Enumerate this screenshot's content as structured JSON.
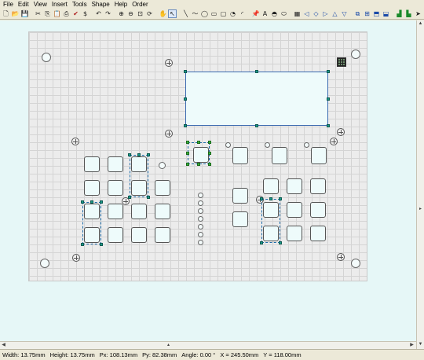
{
  "menu": [
    "File",
    "Edit",
    "View",
    "Insert",
    "Tools",
    "Shape",
    "Help",
    "Order"
  ],
  "toolbar": {
    "buttons": [
      {
        "name": "new-icon",
        "glyph": "🗋"
      },
      {
        "name": "open-icon",
        "glyph": "📂"
      },
      {
        "name": "save-icon",
        "glyph": "💾"
      },
      {
        "name": "cut-icon",
        "glyph": "✂"
      },
      {
        "name": "copy-icon",
        "glyph": "⎘"
      },
      {
        "name": "paste-icon",
        "glyph": "📋"
      },
      {
        "name": "print-icon",
        "glyph": "⎙"
      },
      {
        "name": "spellcheck-icon",
        "glyph": "✔"
      },
      {
        "name": "price-icon",
        "glyph": "$"
      },
      {
        "name": "undo-icon",
        "glyph": "↶"
      },
      {
        "name": "redo-icon",
        "glyph": "↷"
      },
      {
        "name": "zoom-in-icon",
        "glyph": "⊕"
      },
      {
        "name": "zoom-out-icon",
        "glyph": "⊖"
      },
      {
        "name": "zoom-fit-icon",
        "glyph": "⊡"
      },
      {
        "name": "rotate-icon",
        "glyph": "⟳"
      },
      {
        "name": "hand-icon",
        "glyph": "✋"
      },
      {
        "name": "pointer-icon",
        "glyph": "↖"
      },
      {
        "name": "line-icon",
        "glyph": "╲"
      },
      {
        "name": "polyline-icon",
        "glyph": "〜"
      },
      {
        "name": "ellipse-icon",
        "glyph": "◯"
      },
      {
        "name": "rectangle-icon",
        "glyph": "▭"
      },
      {
        "name": "rounded-rect-icon",
        "glyph": "▢"
      },
      {
        "name": "hole-icon",
        "glyph": "◔"
      },
      {
        "name": "arc-icon",
        "glyph": "◜"
      },
      {
        "name": "pin-icon",
        "glyph": "📌"
      },
      {
        "name": "text-icon",
        "glyph": "A"
      },
      {
        "name": "engrave-icon",
        "glyph": "◓"
      },
      {
        "name": "macro-icon",
        "glyph": "⬭"
      },
      {
        "name": "grid-toggle-icon",
        "glyph": "▦"
      },
      {
        "name": "align-left-icon",
        "glyph": "◁"
      },
      {
        "name": "align-center-icon",
        "glyph": "◇"
      },
      {
        "name": "align-right-icon",
        "glyph": "▷"
      },
      {
        "name": "align-top-icon",
        "glyph": "△"
      },
      {
        "name": "align-bottom-icon",
        "glyph": "▽"
      },
      {
        "name": "group-icon",
        "glyph": "⧉"
      },
      {
        "name": "ungroup-icon",
        "glyph": "⊞"
      },
      {
        "name": "order-front-icon",
        "glyph": "⬒"
      },
      {
        "name": "order-back-icon",
        "glyph": "⬓"
      },
      {
        "name": "front-panel-icon",
        "glyph": "▟"
      },
      {
        "name": "back-panel-icon",
        "glyph": "▙"
      },
      {
        "name": "send-order-icon",
        "glyph": "➤"
      }
    ]
  },
  "status": {
    "width": "Width: 13.75mm",
    "height": "Height: 13.75mm",
    "px": "Px: 108.13mm",
    "py": "Py: 82.38mm",
    "angle": "Angle: 0.00 °",
    "x": "X = 245.50mm",
    "y": "Y = 118.00mm"
  }
}
